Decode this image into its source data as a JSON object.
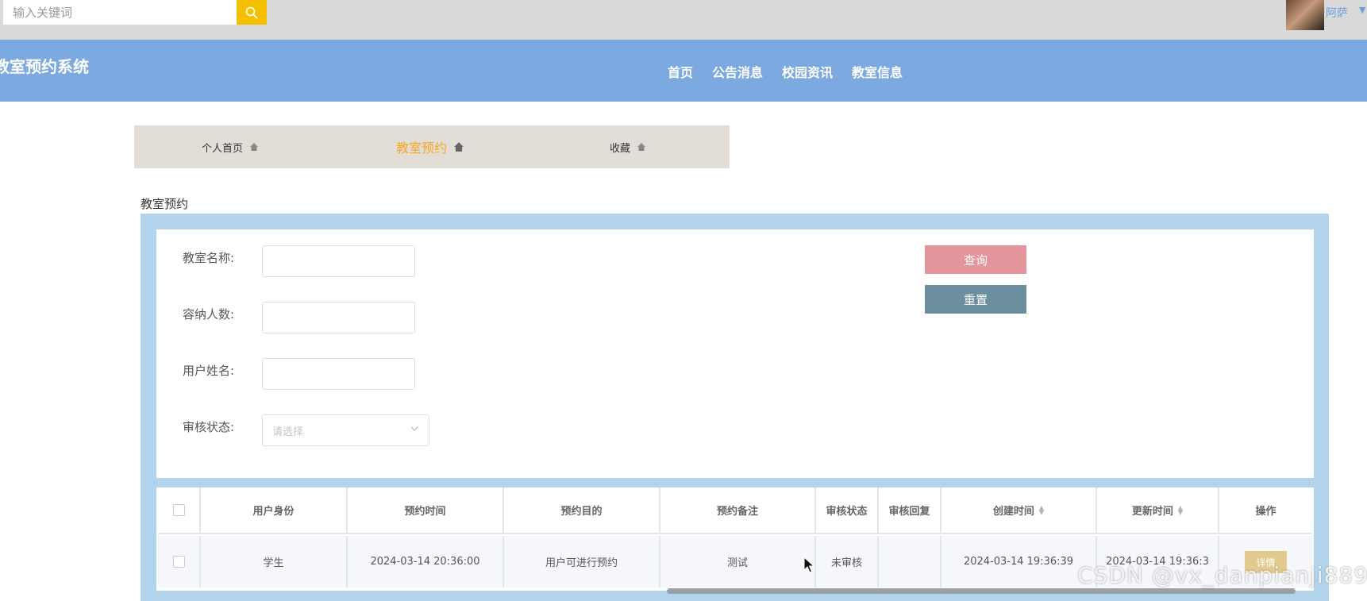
{
  "search": {
    "placeholder": "输入关键词"
  },
  "user": {
    "name": "阿萨"
  },
  "header": {
    "site_title": "教室预约系统",
    "nav": [
      "首页",
      "公告消息",
      "校园资讯",
      "教室信息"
    ]
  },
  "tabs": [
    {
      "label": "个人首页",
      "active": false
    },
    {
      "label": "教室预约",
      "active": true
    },
    {
      "label": "收藏",
      "active": false
    }
  ],
  "section_title": "教室预约",
  "form": {
    "fields": [
      {
        "label": "教室名称:",
        "value": ""
      },
      {
        "label": "容纳人数:",
        "value": ""
      },
      {
        "label": "用户姓名:",
        "value": ""
      },
      {
        "label": "审核状态:",
        "placeholder": "请选择"
      }
    ],
    "query_label": "查询",
    "reset_label": "重置"
  },
  "table": {
    "columns": [
      "用户身份",
      "预约时间",
      "预约目的",
      "预约备注",
      "审核状态",
      "审核回复",
      "创建时间",
      "更新时间",
      "操作"
    ],
    "rows": [
      {
        "identity": "学生",
        "reserve_time": "2024-03-14 20:36:00",
        "purpose": "用户可进行预约",
        "remark": "测试",
        "status": "未审核",
        "reply": "",
        "created": "2024-03-14 19:36:39",
        "updated": "2024-03-14 19:36:3",
        "action": "详情"
      }
    ]
  },
  "watermark": "CSDN @vx_danpianji889",
  "colors": {
    "header_bg": "#7ba9e0",
    "accent_yellow": "#f5c000",
    "tab_active": "#f5a623",
    "query_btn": "#e4959c",
    "reset_btn": "#6c8fa0",
    "panel_bg": "#b1d4ec",
    "detail_btn": "#e2c98e"
  }
}
